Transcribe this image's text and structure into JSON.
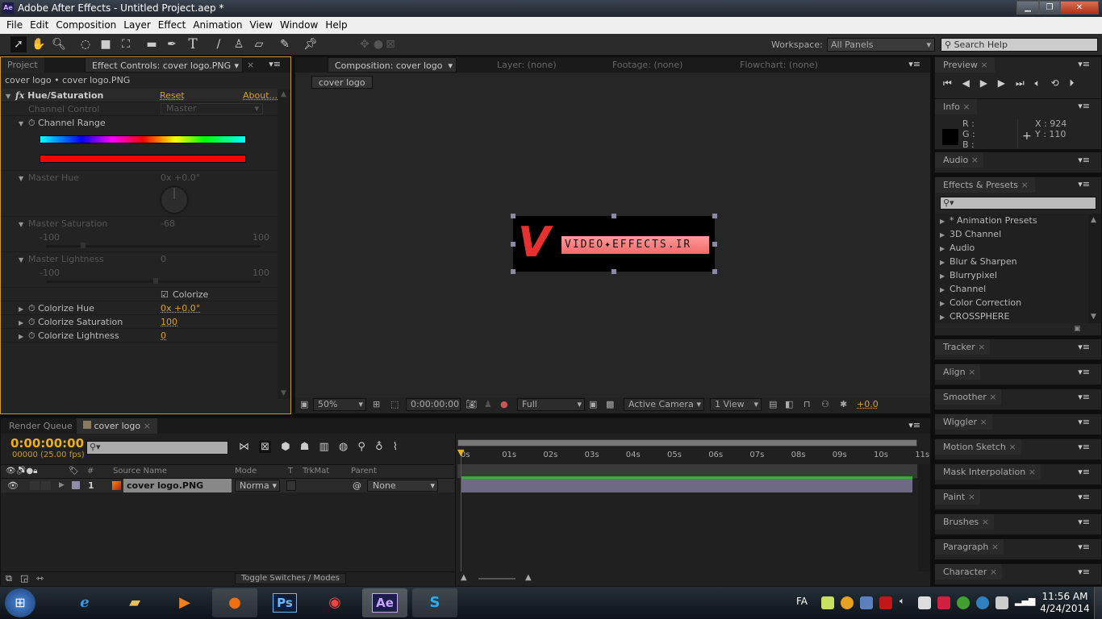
{
  "window": {
    "title": "Adobe After Effects - Untitled Project.aep *",
    "app_logo": "Ae"
  },
  "menu": [
    "File",
    "Edit",
    "Composition",
    "Layer",
    "Effect",
    "Animation",
    "View",
    "Window",
    "Help"
  ],
  "toolbar": {
    "workspace_label": "Workspace:",
    "workspace_value": "All Panels",
    "search_placeholder": "Search Help"
  },
  "left_panel": {
    "tabs": [
      "Project",
      "Effect Controls: cover logo.PNG"
    ],
    "breadcrumb": "cover logo • cover logo.PNG",
    "effect_name": "Hue/Saturation",
    "fx_icon": "fx",
    "reset": "Reset",
    "about": "About...",
    "channel_control_label": "Channel Control",
    "channel_control_value": "Master",
    "channel_range_label": "Channel Range",
    "master_hue_label": "Master Hue",
    "master_hue_value": "0x +0.0°",
    "master_sat_label": "Master Saturation",
    "master_sat_value": "-68",
    "master_sat_slider": -68,
    "master_light_label": "Master Lightness",
    "master_light_value": "0",
    "master_light_slider": 0,
    "range_min": "-100",
    "range_max": "100",
    "colorize_label": "Colorize",
    "colorize_checked": true,
    "props": [
      {
        "label": "Colorize Hue",
        "value": "0x +0.0°"
      },
      {
        "label": "Colorize Saturation",
        "value": "100"
      },
      {
        "label": "Colorize Lightness",
        "value": "0"
      }
    ]
  },
  "comp_panel": {
    "tabs": [
      "Composition: cover logo",
      "Layer: (none)",
      "Footage: (none)",
      "Flowchart: (none)"
    ],
    "comp_button": "cover logo",
    "logo_text": "VIDEO✦EFFECTS.IR",
    "footer": {
      "zoom": "50%",
      "timecode": "0:00:00:00",
      "resolution": "Full",
      "camera": "Active Camera",
      "views": "1 View",
      "exposure": "+0.0"
    }
  },
  "right_panels": {
    "preview": "Preview",
    "info": {
      "title": "Info",
      "r": "R :",
      "g": "G :",
      "b": "B :",
      "x": "X : 924",
      "y": "Y : 110"
    },
    "audio": "Audio",
    "effects": {
      "title": "Effects & Presets",
      "items": [
        "* Animation Presets",
        "3D Channel",
        "Audio",
        "Blur & Sharpen",
        "Blurrypixel",
        "Channel",
        "Color Correction",
        "CROSSPHERE"
      ]
    },
    "collapsed": [
      "Tracker",
      "Align",
      "Smoother",
      "Wiggler",
      "Motion Sketch",
      "Mask Interpolation",
      "Paint",
      "Brushes",
      "Paragraph",
      "Character"
    ]
  },
  "timeline": {
    "tabs": [
      "Render Queue",
      "cover logo"
    ],
    "timecode": "0:00:00:00",
    "frames": "00000 (25.00 fps)",
    "columns": {
      "num": "#",
      "source": "Source Name",
      "mode": "Mode",
      "t": "T",
      "trkmat": "TrkMat",
      "parent": "Parent"
    },
    "layers": [
      {
        "num": "1",
        "name": "cover logo.PNG",
        "mode": "Norma",
        "parent": "None"
      }
    ],
    "ruler": [
      "0s",
      "01s",
      "02s",
      "03s",
      "04s",
      "05s",
      "06s",
      "07s",
      "08s",
      "09s",
      "10s",
      "11s"
    ],
    "toggle": "Toggle Switches / Modes"
  },
  "taskbar": {
    "lang": "FA",
    "time": "11:56 AM",
    "date": "4/24/2014",
    "apps": [
      "Ps",
      "Ae"
    ]
  }
}
